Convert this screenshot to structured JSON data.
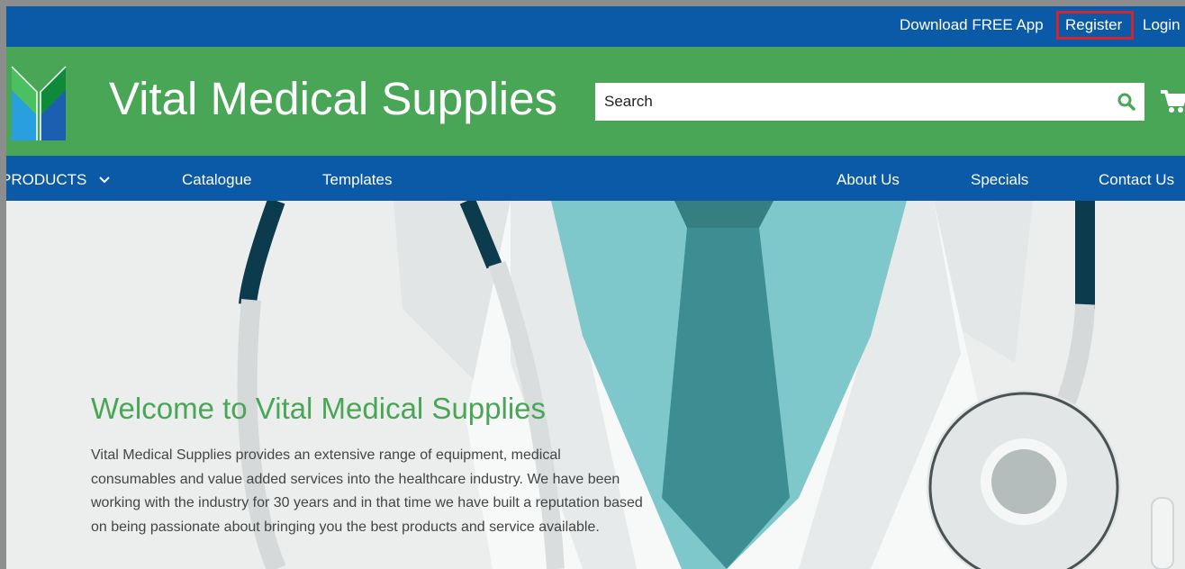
{
  "topbar": {
    "download_app": "Download FREE App",
    "register": "Register",
    "login": "Login"
  },
  "header": {
    "site_title": "Vital Medical Supplies",
    "search_placeholder": "Search"
  },
  "nav": {
    "products": "PRODUCTS",
    "catalogue": "Catalogue",
    "templates": "Templates",
    "about": "About Us",
    "specials": "Specials",
    "contact": "Contact Us"
  },
  "hero": {
    "heading": "Welcome to Vital Medical Supplies",
    "body": "Vital Medical Supplies provides an extensive range of equipment, medical consumables and value added services into the healthcare industry. We have been working with the industry for 30 years and in that time we have built a reputation based on being passionate about bringing you the best products and service available."
  },
  "colors": {
    "brand_blue": "#0a5aa8",
    "brand_green": "#4aa657",
    "highlight_red": "#d6242c"
  },
  "icons": [
    "logo-icon",
    "search-icon",
    "cart-icon",
    "chevron-down-icon"
  ]
}
